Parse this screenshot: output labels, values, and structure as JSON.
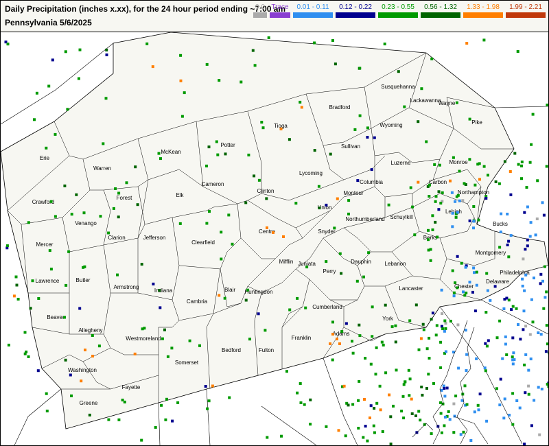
{
  "header": {
    "title": "Daily Precipitation (inches  x.xx),  for the 24 hour period ending ~7:00 am",
    "subtitle": "Pennsylvania 5/6/2025"
  },
  "legend": [
    {
      "label": "0.0",
      "color": "#aaaaaa"
    },
    {
      "label": "Trace",
      "color": "#8a3fd1"
    },
    {
      "label": "0.01 - 0.11",
      "color": "#2f8ff0"
    },
    {
      "label": "0.12 - 0.22",
      "color": "#00008f"
    },
    {
      "label": "0.23 - 0.55",
      "color": "#009a00"
    },
    {
      "label": "0.56 - 1.32",
      "color": "#006400"
    },
    {
      "label": "1.33 - 1.98",
      "color": "#ff7f00"
    },
    {
      "label": "1.99 - 2.21",
      "color": "#c0390b"
    }
  ],
  "counties": [
    {
      "name": "Erie"
    },
    {
      "name": "Warren"
    },
    {
      "name": "McKean"
    },
    {
      "name": "Potter"
    },
    {
      "name": "Tioga"
    },
    {
      "name": "Bradford"
    },
    {
      "name": "Susquehanna"
    },
    {
      "name": "Wayne"
    },
    {
      "name": "Pike"
    },
    {
      "name": "Wyoming"
    },
    {
      "name": "Lackawanna"
    },
    {
      "name": "Sullivan"
    },
    {
      "name": "Crawford"
    },
    {
      "name": "Forest"
    },
    {
      "name": "Elk"
    },
    {
      "name": "Cameron"
    },
    {
      "name": "Clinton"
    },
    {
      "name": "Lycoming"
    },
    {
      "name": "Luzerne"
    },
    {
      "name": "Monroe"
    },
    {
      "name": "Columbia"
    },
    {
      "name": "Montour"
    },
    {
      "name": "Carbon"
    },
    {
      "name": "Venango"
    },
    {
      "name": "Union"
    },
    {
      "name": "Northampton"
    },
    {
      "name": "Lehigh"
    },
    {
      "name": "Northumberland"
    },
    {
      "name": "Schuylkill"
    },
    {
      "name": "Mercer"
    },
    {
      "name": "Clarion"
    },
    {
      "name": "Jefferson"
    },
    {
      "name": "Clearfield"
    },
    {
      "name": "Centre"
    },
    {
      "name": "Snyder"
    },
    {
      "name": "Bucks"
    },
    {
      "name": "Berks"
    },
    {
      "name": "Montgomery"
    },
    {
      "name": "Mifflin"
    },
    {
      "name": "Juniata"
    },
    {
      "name": "Perry"
    },
    {
      "name": "Dauphin"
    },
    {
      "name": "Lebanon"
    },
    {
      "name": "Lawrence"
    },
    {
      "name": "Butler"
    },
    {
      "name": "Armstrong"
    },
    {
      "name": "Indiana"
    },
    {
      "name": "Blair"
    },
    {
      "name": "Huntingdon"
    },
    {
      "name": "Cambria"
    },
    {
      "name": "Philadelphia"
    },
    {
      "name": "Chester"
    },
    {
      "name": "Delaware"
    },
    {
      "name": "Lancaster"
    },
    {
      "name": "Beaver"
    },
    {
      "name": "Allegheny"
    },
    {
      "name": "Cumberland"
    },
    {
      "name": "York"
    },
    {
      "name": "Westmoreland"
    },
    {
      "name": "Adams"
    },
    {
      "name": "Franklin"
    },
    {
      "name": "Fulton"
    },
    {
      "name": "Bedford"
    },
    {
      "name": "Somerset"
    },
    {
      "name": "Washington"
    },
    {
      "name": "Fayette"
    },
    {
      "name": "Greene"
    }
  ]
}
